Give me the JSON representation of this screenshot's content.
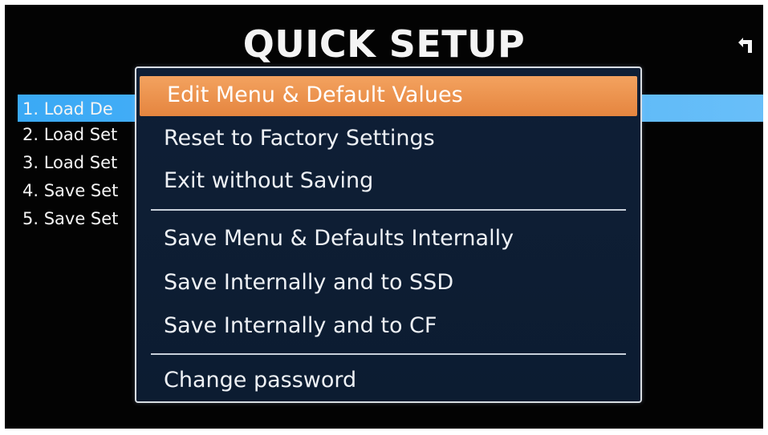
{
  "screen": {
    "title": "QUICK SETUP",
    "back_icon": "return-arrow-icon"
  },
  "background_list": {
    "items": [
      {
        "label": "1. Load De",
        "selected": true
      },
      {
        "label": "2. Load Set",
        "selected": false
      },
      {
        "label": "3. Load Set",
        "selected": false
      },
      {
        "label": "4. Save Set",
        "selected": false
      },
      {
        "label": "5. Save Set",
        "selected": false
      }
    ]
  },
  "popup_menu": {
    "items": [
      {
        "label": "Edit Menu & Default Values",
        "highlighted": true
      },
      {
        "label": "Reset to Factory Settings",
        "highlighted": false
      },
      {
        "label": "Exit without Saving",
        "highlighted": false
      },
      {
        "label": "Save Menu & Defaults Internally",
        "highlighted": false
      },
      {
        "label": "Save Internally and to SSD",
        "highlighted": false
      },
      {
        "label": "Save Internally and to CF",
        "highlighted": false
      },
      {
        "label": "Change password",
        "highlighted": false
      }
    ]
  },
  "colors": {
    "background": "#030303",
    "selection_blue": "#3aa9f5",
    "highlight_orange": "#f3a25f",
    "popup_bg": "#0f1f36",
    "popup_border": "#d8dde3"
  }
}
